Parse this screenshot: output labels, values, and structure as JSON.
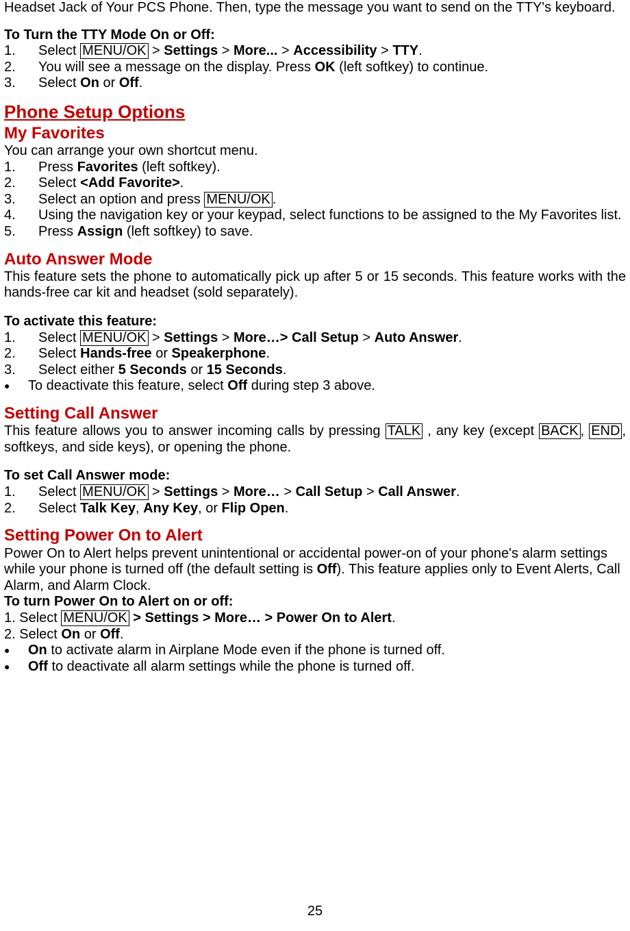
{
  "intro": {
    "line1_a": "Headset Jack of Your PCS Phone. Then, type the message you want to send on the TTY's",
    "line1_b": "keyboard."
  },
  "tty": {
    "heading": "To Turn the TTY Mode On or Off:",
    "n1": "1.",
    "s1_a": "Select ",
    "MENUOK": "MENU/OK",
    "gt": " > ",
    "settings": "Settings",
    "more": "More...",
    "accessibility": "Accessibility",
    "tty": "TTY",
    "dot": ".",
    "n2": "2.",
    "s2_a": "You will see a message on the display. Press ",
    "s2_b": "OK",
    "s2_c": " (left softkey) to continue.",
    "n3": "3.",
    "s3_a": "Select ",
    "on": "On",
    "or": " or ",
    "off": "Off"
  },
  "pso_h1": "Phone Setup Options",
  "myfav": {
    "h2": "My Favorites",
    "p": "You can arrange your own shortcut menu.",
    "n1": "1.",
    "s1_a": "Press ",
    "s1_b": "Favorites",
    "s1_c": " (left softkey).",
    "n2": "2.",
    "s2_a": "Select ",
    "s2_b": "<Add Favorite>",
    "s2_c": ".",
    "n3": "3.",
    "s3_a": "Select an option and press ",
    "MENUOK": "MENU/OK",
    "s3_c": ".",
    "n4": "4.",
    "s4": "Using the navigation key or your keypad, select functions to be assigned to the My Favorites list.",
    "n5": "5.",
    "s5_a": "Press ",
    "s5_b": "Assign",
    "s5_c": " (left softkey) to save."
  },
  "auto": {
    "h2": "Auto Answer Mode",
    "p": "This feature sets the phone to automatically pick up after 5 or 15 seconds. This feature works with the hands-free car kit and headset (sold separately).",
    "h_instr": "To activate this feature:",
    "n1": "1.",
    "s1_a": "Select ",
    "MENUOK": "MENU/OK",
    "gt": " > ",
    "settings": "Settings",
    "more": "More…",
    "callsetup": "Call Setup",
    "autoanswer": "Auto Answer",
    "dot": ".",
    "n2": "2.",
    "s2_a": "Select ",
    "s2_b": "Hands-free",
    "s2_c": " or ",
    "s2_d": "Speakerphone",
    "s2_e": ".",
    "n3": "3.",
    "s3_a": "Select either ",
    "s3_b": "5 Seconds",
    "s3_c": " or ",
    "s3_d": "15 Seconds",
    "s3_e": ".",
    "b1": "To deactivate this feature, select ",
    "b1_b": "Off",
    "b1_c": " during step 3 above."
  },
  "callans": {
    "h2": "Setting Call Answer",
    "p_a": "This feature allows you to answer incoming calls by pressing ",
    "TALK": "TALK",
    "p_b": " , any key (except ",
    "BACK": "BACK",
    "p_c": ", ",
    "END": "END",
    "p_d": ", softkeys, and side keys), or opening the phone.",
    "h_instr": "To set Call Answer mode:",
    "n1": "1.",
    "s1_a": "Select ",
    "MENUOK": "MENU/OK",
    "gt": " > ",
    "settings": "Settings",
    "more": "More…",
    "callsetup": "Call Setup",
    "callanswer": "Call Answer",
    "dot": ".",
    "n2": "2.",
    "s2_a": "Select ",
    "s2_b": "Talk Key",
    "s2_c": ", ",
    "s2_d": "Any Key",
    "s2_e": ", or ",
    "s2_f": "Flip Open",
    "s2_g": "."
  },
  "power": {
    "h2": "Setting Power On to Alert",
    "p_a": "Power On to Alert helps prevent unintentional or accidental power-on of your phone",
    "apos": "'",
    "p_b": "s alarm settings while your phone is turned off (the default setting is ",
    "off": "Off",
    "p_c": "). This feature applies only to Event Alerts, Call Alarm, and Alarm Clock.",
    "h_instr": "To turn Power On to Alert on or off:",
    "s1_a": "1. Select ",
    "MENUOK": "MENU/OK",
    "s1_b": " > Settings > More… > Power On to Alert",
    "dot": ".",
    "s2_a": "2. Select ",
    "on": "On",
    "or": " or ",
    "s2_c": ".",
    "b1_a": "On",
    "b1_b": " to activate alarm in Airplane Mode even if the phone is turned off.",
    "b2_a": "Off",
    "b2_b": " to deactivate all alarm settings while the phone is turned off."
  },
  "page_number": "25"
}
